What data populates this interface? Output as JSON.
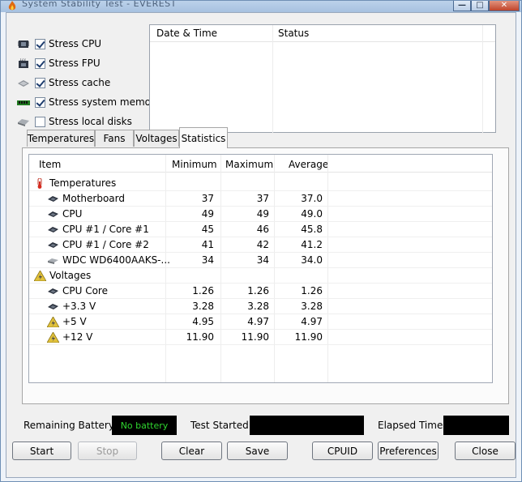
{
  "window": {
    "title": "System Stability Test - EVEREST"
  },
  "stress_options": [
    {
      "label": "Stress CPU",
      "checked": true,
      "icon": "cpu-icon"
    },
    {
      "label": "Stress FPU",
      "checked": true,
      "icon": "fpu-icon"
    },
    {
      "label": "Stress cache",
      "checked": true,
      "icon": "cache-icon"
    },
    {
      "label": "Stress system memory",
      "checked": true,
      "icon": "memory-icon"
    },
    {
      "label": "Stress local disks",
      "checked": false,
      "icon": "disk-icon"
    }
  ],
  "log": {
    "columns": [
      "Date & Time",
      "Status"
    ]
  },
  "tabs": [
    {
      "label": "Temperatures",
      "active": false
    },
    {
      "label": "Fans",
      "active": false
    },
    {
      "label": "Voltages",
      "active": false
    },
    {
      "label": "Statistics",
      "active": true
    }
  ],
  "stats": {
    "columns": [
      "Item",
      "Minimum",
      "Maximum",
      "Average"
    ],
    "rows": [
      {
        "type": "group",
        "name": "Temperatures",
        "icon": "thermometer-icon"
      },
      {
        "type": "item",
        "name": "Motherboard",
        "icon": "motherboard-icon",
        "min": "37",
        "max": "37",
        "avg": "37.0"
      },
      {
        "type": "item",
        "name": "CPU",
        "icon": "cpu-icon",
        "min": "49",
        "max": "49",
        "avg": "49.0"
      },
      {
        "type": "item",
        "name": "CPU #1 / Core #1",
        "icon": "cpu-icon",
        "min": "45",
        "max": "46",
        "avg": "45.8"
      },
      {
        "type": "item",
        "name": "CPU #1 / Core #2",
        "icon": "cpu-icon",
        "min": "41",
        "max": "42",
        "avg": "41.2"
      },
      {
        "type": "item",
        "name": "WDC WD6400AAKS-...",
        "icon": "disk-icon",
        "min": "34",
        "max": "34",
        "avg": "34.0"
      },
      {
        "type": "group",
        "name": "Voltages",
        "icon": "voltage-icon"
      },
      {
        "type": "item",
        "name": "CPU Core",
        "icon": "cpu-icon",
        "min": "1.26",
        "max": "1.26",
        "avg": "1.26"
      },
      {
        "type": "item",
        "name": "+3.3 V",
        "icon": "cpu-icon",
        "min": "3.28",
        "max": "3.28",
        "avg": "3.28"
      },
      {
        "type": "item",
        "name": "+5 V",
        "icon": "voltage-icon",
        "min": "4.95",
        "max": "4.97",
        "avg": "4.97"
      },
      {
        "type": "item",
        "name": "+12 V",
        "icon": "voltage-icon",
        "min": "11.90",
        "max": "11.90",
        "avg": "11.90"
      }
    ]
  },
  "status": {
    "battery_label": "Remaining Battery:",
    "battery_value": "No battery",
    "test_started_label": "Test Started:",
    "test_started_value": "",
    "elapsed_label": "Elapsed Time:",
    "elapsed_value": ""
  },
  "buttons": {
    "start": "Start",
    "stop": "Stop",
    "clear": "Clear",
    "save": "Save",
    "cpuid": "CPUID",
    "preferences": "Preferences",
    "close": "Close"
  },
  "colors": {
    "battery_text": "#2fd52f",
    "info_box": "#000000",
    "window_frame": "#6f8fb5"
  }
}
